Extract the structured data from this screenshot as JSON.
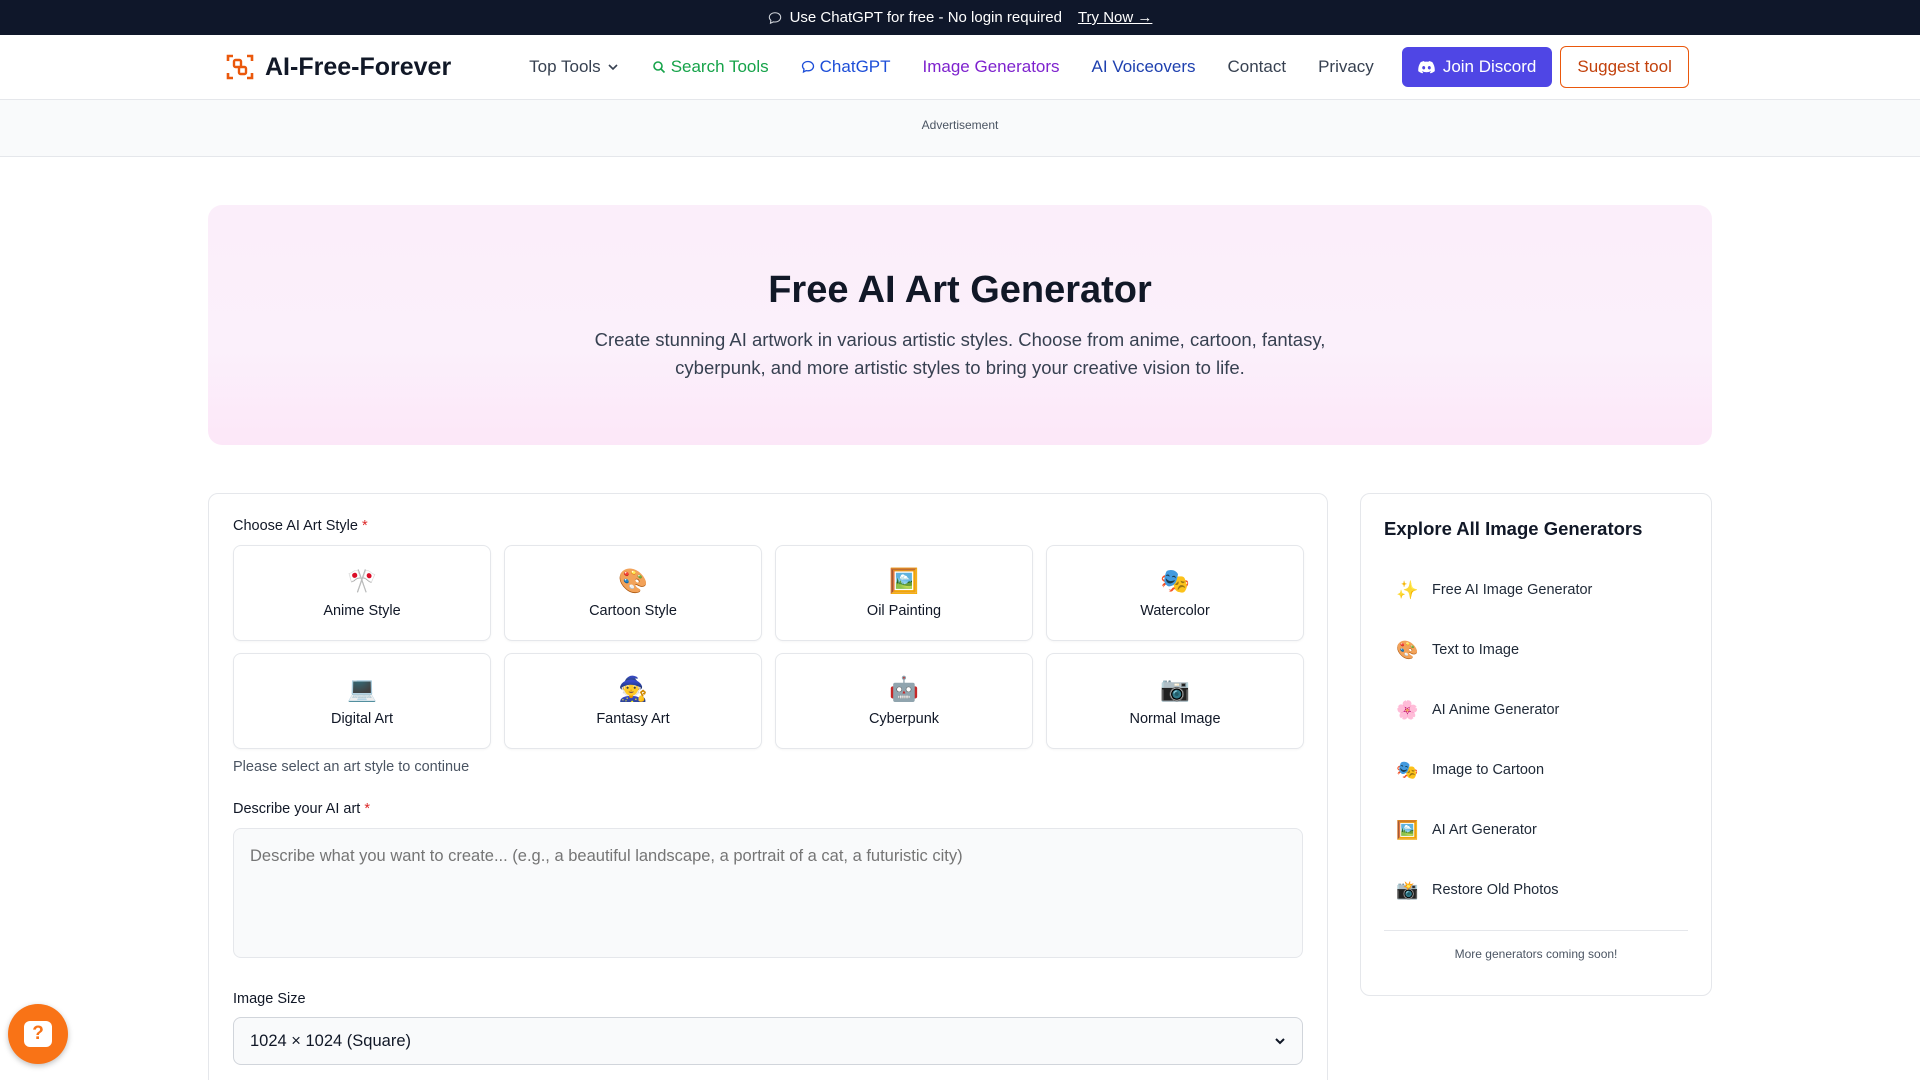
{
  "banner": {
    "text": "Use ChatGPT for free - No login required",
    "link": "Try Now →"
  },
  "nav": {
    "logo": "AI-Free-Forever",
    "links": [
      "Top Tools",
      "Search Tools",
      "ChatGPT",
      "Image Generators",
      "AI Voiceovers",
      "Contact",
      "Privacy"
    ],
    "discord": "Join Discord",
    "suggest": "Suggest tool"
  },
  "ad": "Advertisement",
  "hero": {
    "title": "Free AI Art Generator",
    "subtitle": "Create stunning AI artwork in various artistic styles. Choose from anime, cartoon, fantasy, cyberpunk, and more artistic styles to bring your creative vision to life."
  },
  "form": {
    "style_label": "Choose AI Art Style",
    "required_mark": "*",
    "styles": [
      {
        "emoji": "🎌",
        "label": "Anime Style"
      },
      {
        "emoji": "🎨",
        "label": "Cartoon Style"
      },
      {
        "emoji": "🖼️",
        "label": "Oil Painting"
      },
      {
        "emoji": "🎭",
        "label": "Watercolor"
      },
      {
        "emoji": "💻",
        "label": "Digital Art"
      },
      {
        "emoji": "🧙",
        "label": "Fantasy Art"
      },
      {
        "emoji": "🤖",
        "label": "Cyberpunk"
      },
      {
        "emoji": "📷",
        "label": "Normal Image"
      }
    ],
    "style_hint": "Please select an art style to continue",
    "describe_label": "Describe your AI art",
    "describe_placeholder": "Describe what you want to create... (e.g., a beautiful landscape, a portrait of a cat, a futuristic city)",
    "size_label": "Image Size",
    "size_value": "1024 × 1024 (Square)"
  },
  "sidebar": {
    "title": "Explore All Image Generators",
    "items": [
      {
        "emoji": "✨",
        "label": "Free AI Image Generator"
      },
      {
        "emoji": "🎨",
        "label": "Text to Image"
      },
      {
        "emoji": "🌸",
        "label": "AI Anime Generator"
      },
      {
        "emoji": "🎭",
        "label": "Image to Cartoon"
      },
      {
        "emoji": "🖼️",
        "label": "AI Art Generator"
      },
      {
        "emoji": "📸",
        "label": "Restore Old Photos"
      }
    ],
    "footer": "More generators coming soon!"
  },
  "fab": {
    "label": "?"
  },
  "colors": {
    "discord": "#4f46e5",
    "suggest": "#ea580c",
    "fab": "#f97316",
    "banner": "#0f172a"
  }
}
